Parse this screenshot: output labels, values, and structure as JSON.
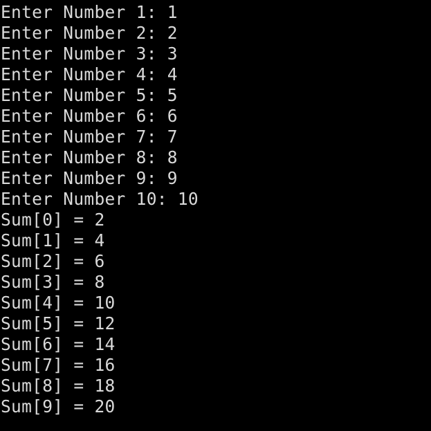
{
  "colors": {
    "background": "#000000",
    "text": "#d9d9d9"
  },
  "terminal": {
    "lines": [
      "Enter Number 1: 1",
      "Enter Number 2: 2",
      "Enter Number 3: 3",
      "Enter Number 4: 4",
      "Enter Number 5: 5",
      "Enter Number 6: 6",
      "Enter Number 7: 7",
      "Enter Number 8: 8",
      "Enter Number 9: 9",
      "Enter Number 10: 10",
      "Sum[0] = 2",
      "Sum[1] = 4",
      "Sum[2] = 6",
      "Sum[3] = 8",
      "Sum[4] = 10",
      "Sum[5] = 12",
      "Sum[6] = 14",
      "Sum[7] = 16",
      "Sum[8] = 18",
      "Sum[9] = 20"
    ]
  }
}
